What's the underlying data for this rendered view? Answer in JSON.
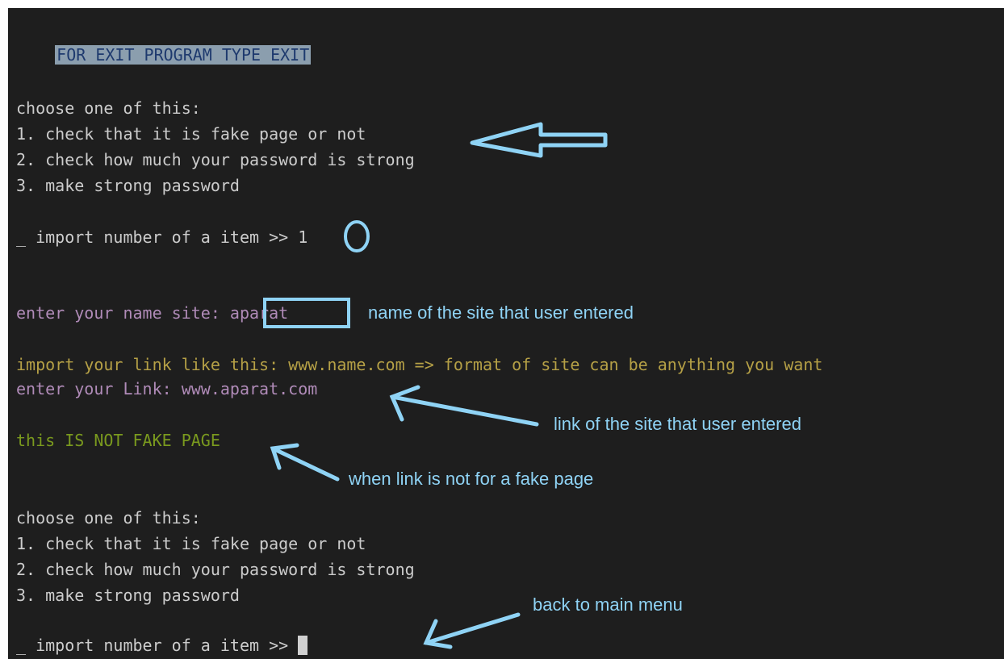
{
  "terminal": {
    "banner": "FOR EXIT PROGRAM TYPE EXIT",
    "menu_header": "choose one of this:",
    "menu_items": [
      "1. check that it is fake page or not",
      "2. check how much your password is strong",
      "3. make strong password"
    ],
    "prompt_prefix": "_ import number of a item >>",
    "first_selection": "1",
    "site_prompt": "enter your name site:",
    "site_value": "aparat",
    "link_instruction": "import your link like this: www.name.com => format of site can be anything you want",
    "link_prompt": "enter your Link:",
    "link_value": "www.aparat.com",
    "result": "this IS NOT FAKE PAGE"
  },
  "annotations": {
    "site_note": "name of the site that user entered",
    "link_note": "link of the site that user entered",
    "result_note": "when link is not for a fake page",
    "menu_note": "back to main menu"
  },
  "colors": {
    "background": "#1e1e1e",
    "text": "#cccccc",
    "prompt_purple": "#b08bb8",
    "instruction_olive": "#b5a046",
    "result_green": "#7a9a1e",
    "annotation_cyan": "#8fd3f5"
  }
}
